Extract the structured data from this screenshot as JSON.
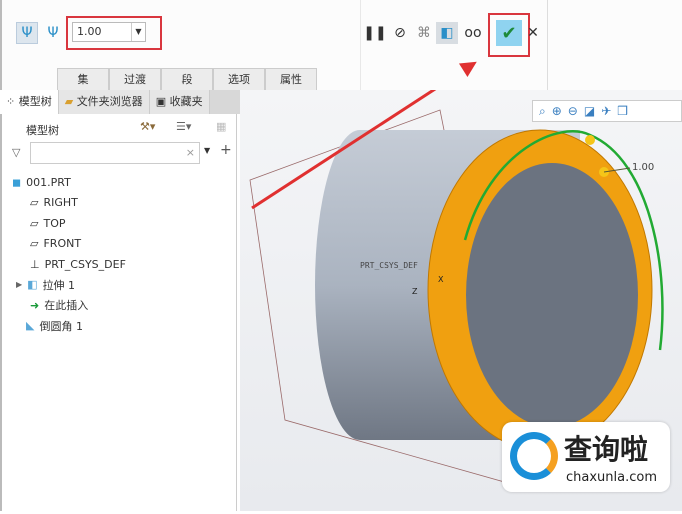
{
  "toolbar": {
    "value": "1.00",
    "tabs": [
      "集",
      "过渡",
      "段",
      "选项",
      "属性"
    ],
    "icons": [
      "fillet-set-icon",
      "fillet-transition-icon",
      "pause-icon",
      "no-preview-icon",
      "geometry-preview-icon",
      "verify-preview-icon",
      "glasses-icon",
      "confirm-check-icon",
      "cancel-x-icon"
    ]
  },
  "panel": {
    "tabs": [
      "模型树",
      "文件夹浏览器",
      "收藏夹"
    ],
    "title": "模型树",
    "search_placeholder": "",
    "items": [
      {
        "label": "001.PRT",
        "icon": "part-icon"
      },
      {
        "label": "RIGHT",
        "icon": "datum-plane-icon"
      },
      {
        "label": "TOP",
        "icon": "datum-plane-icon"
      },
      {
        "label": "FRONT",
        "icon": "datum-plane-icon"
      },
      {
        "label": "PRT_CSYS_DEF",
        "icon": "csys-icon"
      },
      {
        "label": "拉伸 1",
        "icon": "extrude-icon"
      },
      {
        "label": "在此插入",
        "icon": "insert-arrow-icon"
      },
      {
        "label": "倒圆角 1",
        "icon": "round-icon"
      }
    ]
  },
  "view": {
    "csys_label": "PRT_CSYS_DEF",
    "dim_label": "1.00",
    "axis_z": "Z",
    "axis_x": "X"
  },
  "watermark": {
    "name": "查询啦",
    "url": "chaxunla.com"
  },
  "colors": {
    "accent": "#2a8fc8",
    "highlight": "#d9363e",
    "fillet": "#f0a010",
    "green": "#22aa33"
  }
}
